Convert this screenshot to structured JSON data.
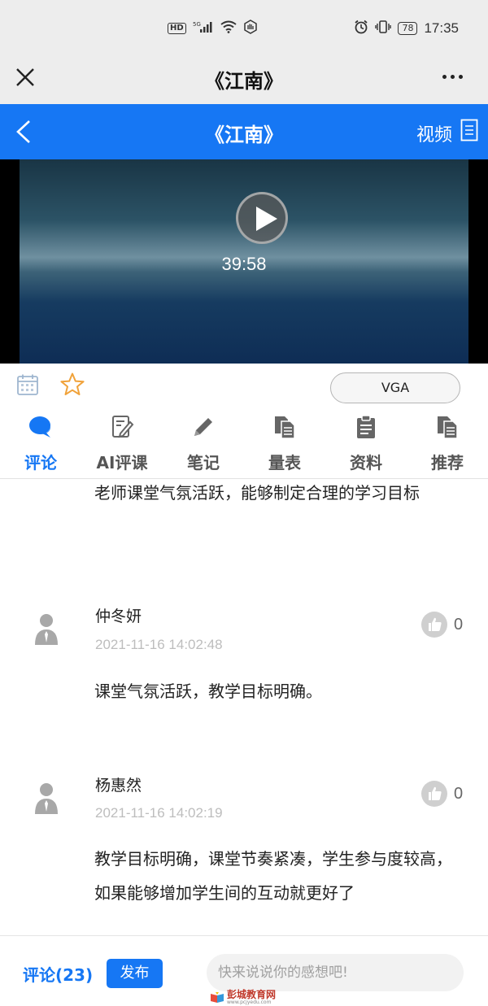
{
  "status_bar": {
    "hd": "HD",
    "net": "5G",
    "battery": "78",
    "time": "17:35"
  },
  "title_bar": {
    "title": "《江南》"
  },
  "nav_bar": {
    "title": "《江南》",
    "video_link": "视频"
  },
  "video": {
    "duration": "39:58"
  },
  "quality": {
    "label": "VGA"
  },
  "tabs": [
    {
      "label": "评论",
      "icon": "chat-bubble-icon",
      "active": true
    },
    {
      "label": "AI评课",
      "icon": "edit-note-icon",
      "active": false
    },
    {
      "label": "笔记",
      "icon": "pencil-icon",
      "active": false
    },
    {
      "label": "量表",
      "icon": "documents-icon",
      "active": false
    },
    {
      "label": "资料",
      "icon": "clipboard-icon",
      "active": false
    },
    {
      "label": "推荐",
      "icon": "documents-icon",
      "active": false
    }
  ],
  "comments": {
    "partial_text": "老师课堂气氛活跃，能够制定合理的学习目标",
    "items": [
      {
        "name": "仲冬妍",
        "time": "2021-11-16 14:02:48",
        "text": "课堂气氛活跃，教学目标明确。",
        "likes": "0"
      },
      {
        "name": "杨惠然",
        "time": "2021-11-16 14:02:19",
        "text": "教学目标明确，课堂节奏紧凑，学生参与度较高，如果能够增加学生间的互动就更好了",
        "likes": "0"
      }
    ]
  },
  "bottom_bar": {
    "comment_count": "评论(23)",
    "publish_label": "发布",
    "input_placeholder": "快来说说你的感想吧!"
  },
  "watermark": {
    "text": "彭城教育网",
    "sub": "www.pcjyedu.com"
  },
  "colors": {
    "accent": "#1677f4",
    "star": "#f0a23a",
    "muted": "#bdbdbd"
  }
}
